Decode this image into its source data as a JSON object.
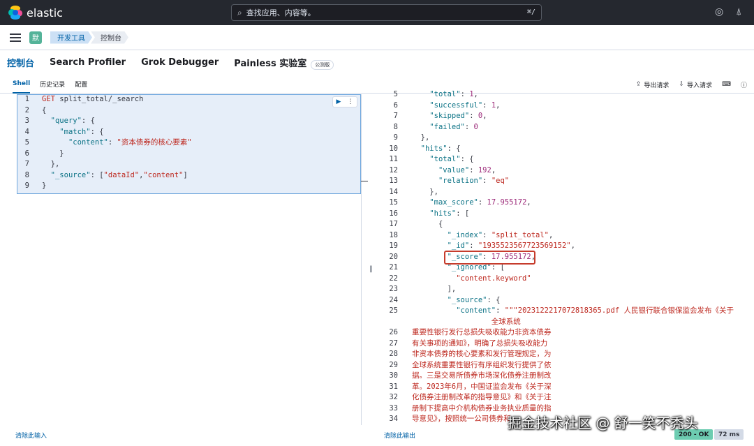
{
  "header": {
    "brand": "elastic",
    "search_placeholder": "查找应用、内容等。",
    "search_shortcut": "⌘/"
  },
  "breadcrumb": {
    "avatar": "默",
    "items": [
      "开发工具",
      "控制台"
    ]
  },
  "tool_tabs": [
    {
      "label": "控制台",
      "active": true
    },
    {
      "label": "Search Profiler"
    },
    {
      "label": "Grok Debugger"
    },
    {
      "label": "Painless 实验室",
      "badge": "公测版"
    }
  ],
  "sub_tabs": [
    {
      "label": "Shell",
      "active": true
    },
    {
      "label": "历史记录"
    },
    {
      "label": "配置"
    }
  ],
  "actions": {
    "export": "导出请求",
    "import": "导入请求"
  },
  "request": {
    "line_numbers": [
      "1",
      "2",
      "3",
      "4",
      "5",
      "6",
      "7",
      "8",
      "9"
    ],
    "lines": [
      "GET split_total/_search",
      "{",
      "  \"query\": {",
      "    \"match\": {",
      "      \"content\": \"资本债券的核心要素\"",
      "    }",
      "  },",
      "  \"_source\": [\"dataId\",\"content\"]",
      "}"
    ]
  },
  "response": {
    "line_numbers": [
      "5",
      "6",
      "7",
      "8",
      "9",
      "10",
      "11",
      "12",
      "13",
      "14",
      "15",
      "16",
      "17",
      "18",
      "19",
      "20",
      "21",
      "22",
      "23",
      "24",
      "25",
      "",
      "26",
      "27",
      "28",
      "29",
      "30",
      "31",
      "32",
      "33",
      "34"
    ],
    "lines": [
      "    \"total\": 1,",
      "    \"successful\": 1,",
      "    \"skipped\": 0,",
      "    \"failed\": 0",
      "  },",
      "  \"hits\": {",
      "    \"total\": {",
      "      \"value\": 192,",
      "      \"relation\": \"eq\"",
      "    },",
      "    \"max_score\": 17.955172,",
      "    \"hits\": [",
      "      {",
      "        \"_index\": \"split_total\",",
      "        \"_id\": \"1935523567723569152\",",
      "        \"_score\": 17.955172,",
      "        \"_ignored\": [",
      "          \"content.keyword\"",
      "        ],",
      "        \"_source\": {",
      "          \"content\": \"\"\"2023122217072818365.pdf 人民银行联合银保监会发布《关于",
      "                  全球系统",
      "重要性银行发行总损失吸收能力非资本债券",
      "有关事项的通知》，明确了总损失吸收能力",
      "非资本债券的核心要素和发行管理规定，为",
      "全球系统重要性银行有序组织发行提供了依",
      "据。三是交易所债券市场深化债券注册制改",
      "革。2023年6月，中国证监会发布《关于深",
      "化债券注册制改革的指导意见》和《关于注",
      "册制下提高中介机构债券业务执业质量的指",
      "导意见》，按照统一公司债券和"
    ]
  },
  "footer": {
    "clear_input": "清除此输入",
    "clear_output": "清除此输出",
    "status": "200 - OK",
    "time": "72 ms"
  },
  "watermark": "掘金技术社区 @ 舒一笑不秃头",
  "colors": {
    "topbar": "#25282f",
    "accent": "#0061a6",
    "highlight": "#c63c2c",
    "ok": "#6dccb1"
  }
}
